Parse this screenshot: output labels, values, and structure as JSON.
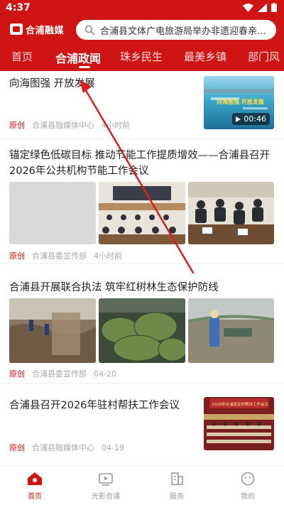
{
  "status": {
    "time": "4:37"
  },
  "app": {
    "logo_text": "合浦融媒"
  },
  "search": {
    "text": "合浦县文体广电旅游局举办非遗迎春亲..."
  },
  "tabs": [
    {
      "label": "首页"
    },
    {
      "label": "合浦政闻"
    },
    {
      "label": "珠乡民生"
    },
    {
      "label": "最美乡镇"
    },
    {
      "label": "部门风"
    }
  ],
  "articles": [
    {
      "title": "向海图强 开放发展",
      "tag": "原创",
      "source": "合浦县融媒体中心",
      "time": "4小时前",
      "thumb_caption": "向海图强 开放发展",
      "duration": "00:46"
    },
    {
      "title": "锚定绿色低碳目标 推动节能工作提质增效——合浦县召开2026年公共机构节能工作会议",
      "tag": "原创",
      "source": "合浦县委宣传部",
      "time": "4小时前"
    },
    {
      "title": "合浦县开展联合执法 筑牢红树林生态保护防线",
      "tag": "原创",
      "source": "合浦县委宣传部",
      "time": "04-20"
    },
    {
      "title": "合浦县召开2026年驻村帮扶工作会议",
      "tag": "原创",
      "source": "合浦县融媒体中心",
      "time": "04-19",
      "thumb_caption": "2026年合浦县驻村帮扶工作会议"
    }
  ],
  "bottom_nav": [
    {
      "label": "首页",
      "icon": "home-icon"
    },
    {
      "label": "光影合浦",
      "icon": "video-icon"
    },
    {
      "label": "服务",
      "icon": "service-icon"
    },
    {
      "label": "我的",
      "icon": "profile-icon"
    }
  ],
  "colors": {
    "brand": "#cf1414",
    "annotation_arrow": "#d81e1e"
  }
}
